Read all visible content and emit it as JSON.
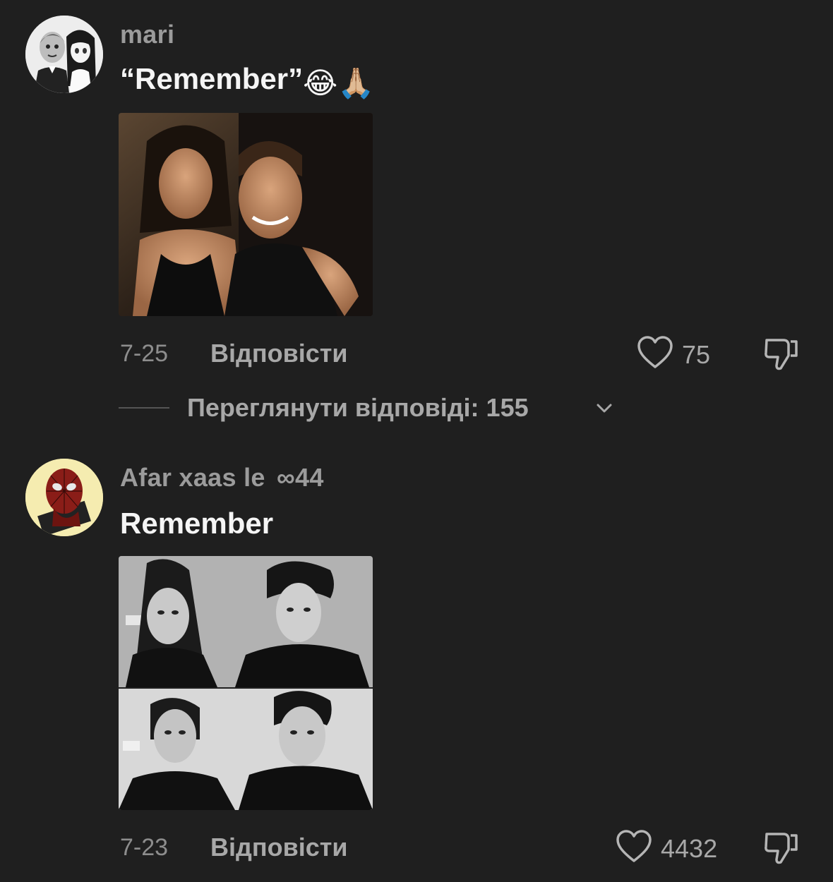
{
  "comments": [
    {
      "username": "mari",
      "text": "“Remember”",
      "emojis": [
        "😂",
        "🙏🏼"
      ],
      "date": "7-25",
      "reply_label": "Відповісти",
      "likes": "75",
      "avatar_icon": "cartoon-couple-avatar",
      "image_description_icon": "photo-couple"
    },
    {
      "username": "Afar xaas le",
      "username_suffix": "∞44",
      "text": "Remember",
      "date": "7-23",
      "reply_label": "Відповісти",
      "likes": "4432",
      "avatar_icon": "spiderman-avatar",
      "image_description_icon": "photo-couple-grayscale"
    }
  ],
  "view_replies": {
    "label": "Переглянути відповіді: 155"
  },
  "colors": {
    "background": "#1f1f1f",
    "username": "#9b9b9b",
    "text": "#f5f5f5",
    "meta": "#a8a8a8"
  }
}
